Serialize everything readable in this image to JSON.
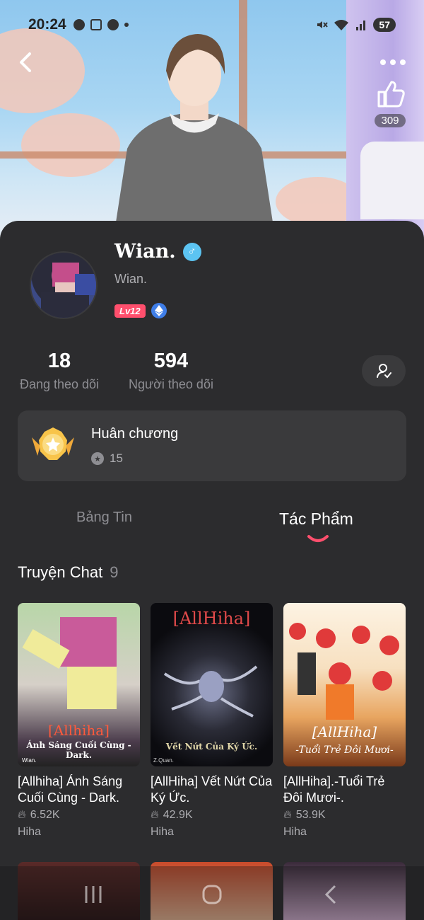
{
  "status_bar": {
    "time": "20:24",
    "battery": "57"
  },
  "header": {
    "likes": "309"
  },
  "profile": {
    "name": "Wian.",
    "handle": "Wian.",
    "level_badge": "Lv12"
  },
  "stats": {
    "following_count": "18",
    "following_label": "Đang theo dõi",
    "followers_count": "594",
    "followers_label": "Người theo dõi"
  },
  "medal": {
    "title": "Huân chương",
    "count": "15"
  },
  "tabs": [
    {
      "label": "Bảng Tin",
      "active": false
    },
    {
      "label": "Tác Phẩm",
      "active": true
    }
  ],
  "section": {
    "title": "Truyện Chat",
    "count": "9"
  },
  "works": [
    {
      "title": "[Allhiha] Ánh Sáng Cuối Cùng - Dark.",
      "views": "6.52K",
      "author": "Hiha",
      "cover_tag": "[Allhiha]",
      "cover_subtitle": "Ánh Sáng Cuối Cùng - Dark.",
      "cover_credit": "Wian."
    },
    {
      "title": "[AllHiha] Vết Nứt Của Ký Ức.",
      "views": "42.9K",
      "author": "Hiha",
      "cover_tag": "[AllHiha]",
      "cover_subtitle": "Vết Nứt Của Ký Ức.",
      "cover_credit": "Z.Quan."
    },
    {
      "title": "[AllHiha].-Tuổi Trẻ Đôi Mươi-.",
      "views": "53.9K",
      "author": "Hiha",
      "cover_tag": "[AllHiha]",
      "cover_subtitle": "-Tuổi Trẻ Đôi Mươi-",
      "cover_credit": ""
    }
  ],
  "colors": {
    "background": "#2c2c2e",
    "card": "#3a3a3c",
    "accent": "#ff4f6d",
    "gender": "#5cc4f2"
  },
  "icons": [
    "back-icon",
    "more-icon",
    "thumbs-up-icon",
    "male-icon",
    "eth-icon",
    "user-check-icon",
    "medal-icon",
    "star-icon",
    "flame-icon"
  ]
}
